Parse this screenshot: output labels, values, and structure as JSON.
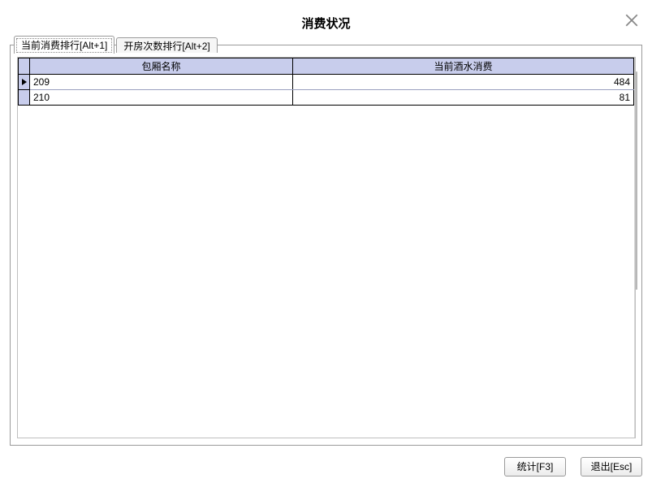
{
  "dialog": {
    "title": "消费状况",
    "close_icon": "close"
  },
  "tabs": [
    {
      "label": "当前消费排行[Alt+1]",
      "active": true
    },
    {
      "label": "开房次数排行[Alt+2]",
      "active": false
    }
  ],
  "table": {
    "columns": [
      "包厢名称",
      "当前酒水消费"
    ],
    "rows": [
      {
        "room": "209",
        "amount": "484",
        "current": true
      },
      {
        "room": "210",
        "amount": "81",
        "current": false
      }
    ]
  },
  "buttons": {
    "stats": "统计[F3]",
    "exit": "退出[Esc]"
  }
}
